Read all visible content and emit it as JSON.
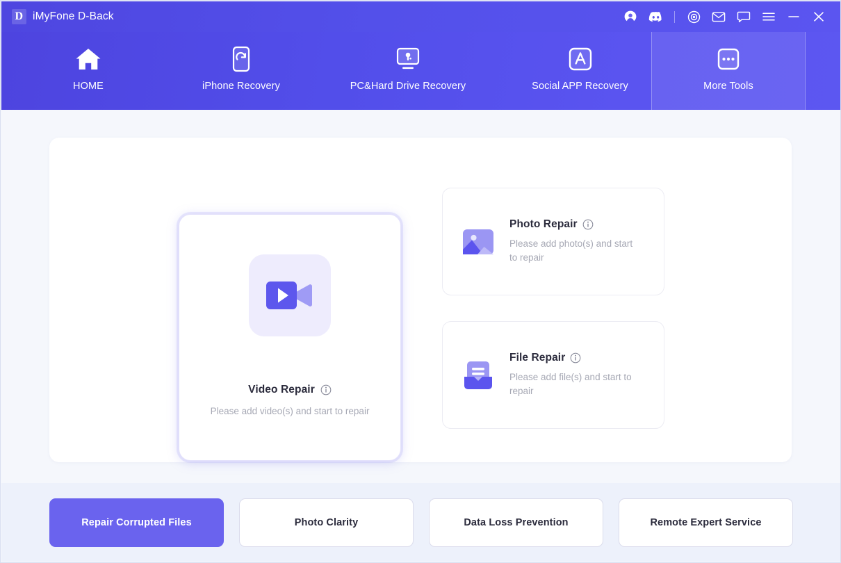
{
  "window": {
    "title": "iMyFone D-Back",
    "logo_letter": "D",
    "titlebar_icons": [
      {
        "name": "account-icon",
        "label": "Account"
      },
      {
        "name": "discord-icon",
        "label": "Discord"
      },
      {
        "name": "target-icon",
        "label": "Settings"
      },
      {
        "name": "mail-icon",
        "label": "Mail"
      },
      {
        "name": "chat-icon",
        "label": "Feedback"
      },
      {
        "name": "menu-icon",
        "label": "Menu"
      },
      {
        "name": "minimize-icon",
        "label": "Minimize"
      },
      {
        "name": "close-icon",
        "label": "Close"
      }
    ]
  },
  "nav": {
    "tabs": [
      {
        "label": "HOME",
        "icon": "home-icon",
        "active": false
      },
      {
        "label": "iPhone Recovery",
        "icon": "phone-refresh-icon",
        "active": false
      },
      {
        "label": "PC&Hard Drive Recovery",
        "icon": "monitor-icon",
        "active": false
      },
      {
        "label": "Social APP Recovery",
        "icon": "app-store-icon",
        "active": false
      },
      {
        "label": "More Tools",
        "icon": "ellipsis-icon",
        "active": true
      }
    ]
  },
  "main": {
    "video_card": {
      "title": "Video Repair",
      "description": "Please add video(s) and start to repair",
      "icon": "video-camera-icon",
      "info_icon": "info-icon",
      "selected": true
    },
    "photo_card": {
      "title": "Photo Repair",
      "description": "Please add photo(s) and start to repair",
      "icon": "photo-image-icon",
      "info_icon": "info-icon"
    },
    "file_card": {
      "title": "File Repair",
      "description": "Please add file(s) and start to repair",
      "icon": "file-document-icon",
      "info_icon": "info-icon"
    }
  },
  "bottom": {
    "buttons": [
      {
        "label": "Repair Corrupted Files",
        "active": true
      },
      {
        "label": "Photo Clarity",
        "active": false
      },
      {
        "label": "Data Loss Prevention",
        "active": false
      },
      {
        "label": "Remote Expert Service",
        "active": false
      }
    ]
  },
  "colors": {
    "brand_purple": "#6a63ee",
    "header_gradient_start": "#4d44df",
    "header_gradient_end": "#5c57f1",
    "body_bg": "#f5f7fc",
    "bottom_bg": "#edf1fb",
    "title_text": "#2b2b3c",
    "muted_text": "#a6a8b4"
  }
}
